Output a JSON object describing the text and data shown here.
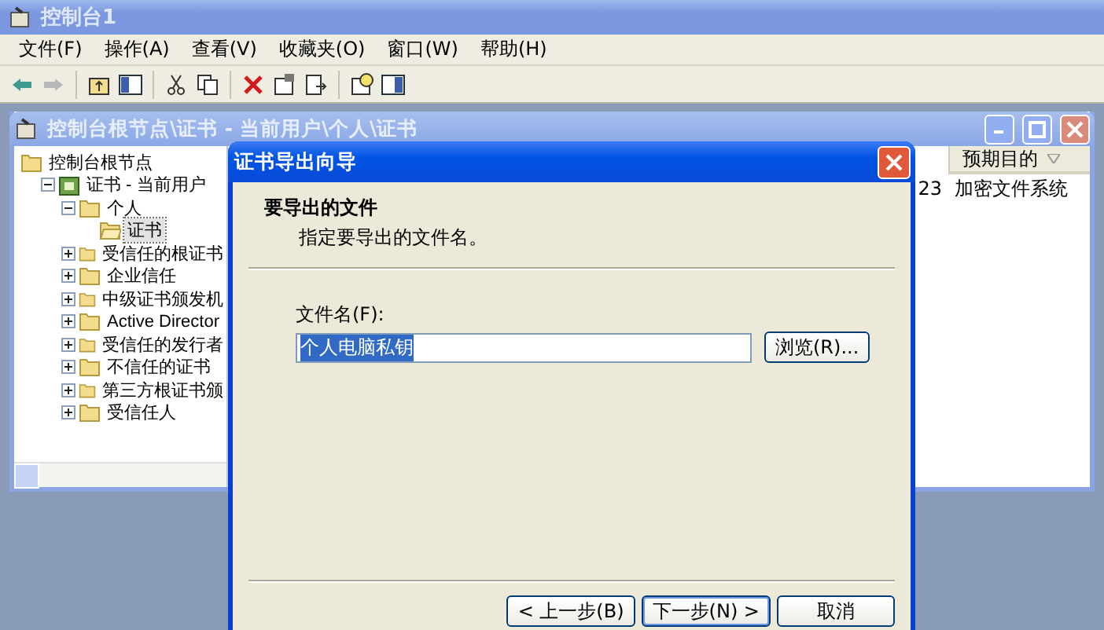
{
  "window": {
    "title": "控制台1"
  },
  "menu": [
    {
      "label": "文件(F)"
    },
    {
      "label": "操作(A)"
    },
    {
      "label": "查看(V)"
    },
    {
      "label": "收藏夹(O)"
    },
    {
      "label": "窗口(W)"
    },
    {
      "label": "帮助(H)"
    }
  ],
  "child_window": {
    "title": "控制台根节点\\证书 - 当前用户\\个人\\证书"
  },
  "tree": [
    {
      "label": "控制台根节点",
      "selected": false,
      "children": [
        {
          "label": "证书 - 当前用户",
          "kind": "store",
          "expanded": true,
          "selected": false,
          "children": [
            {
              "label": "个人",
              "expanded": true,
              "selected": false,
              "children": [
                {
                  "label": "证书",
                  "selected": true
                }
              ]
            },
            {
              "label": "受信任的根证书",
              "expanded": false,
              "selected": false
            },
            {
              "label": "企业信任",
              "expanded": false,
              "selected": false
            },
            {
              "label": "中级证书颁发机",
              "expanded": false,
              "selected": false
            },
            {
              "label": "Active Director",
              "expanded": false,
              "selected": false
            },
            {
              "label": "受信任的发行者",
              "expanded": false,
              "selected": false
            },
            {
              "label": "不信任的证书",
              "expanded": false,
              "selected": false
            },
            {
              "label": "第三方根证书颁",
              "expanded": false,
              "selected": false
            },
            {
              "label": "受信任人",
              "expanded": false,
              "selected": false
            }
          ]
        }
      ]
    }
  ],
  "list": {
    "columns": [
      {},
      {
        "label": "预期目的"
      }
    ],
    "rows": [
      {
        "cells": [
          "23",
          "加密文件系统"
        ]
      }
    ]
  },
  "dialog": {
    "title": "证书导出向导",
    "heading": "要导出的文件",
    "subheading": "指定要导出的文件名。",
    "file_label": "文件名(F):",
    "file_value": "个人电脑私钥",
    "value_selected": true,
    "browse_button": "浏览(R)...",
    "buttons": [
      {
        "label": "< 上一步(B)",
        "default": false
      },
      {
        "label": "下一步(N) >",
        "default": true
      },
      {
        "label": "取消",
        "default": false
      }
    ]
  }
}
